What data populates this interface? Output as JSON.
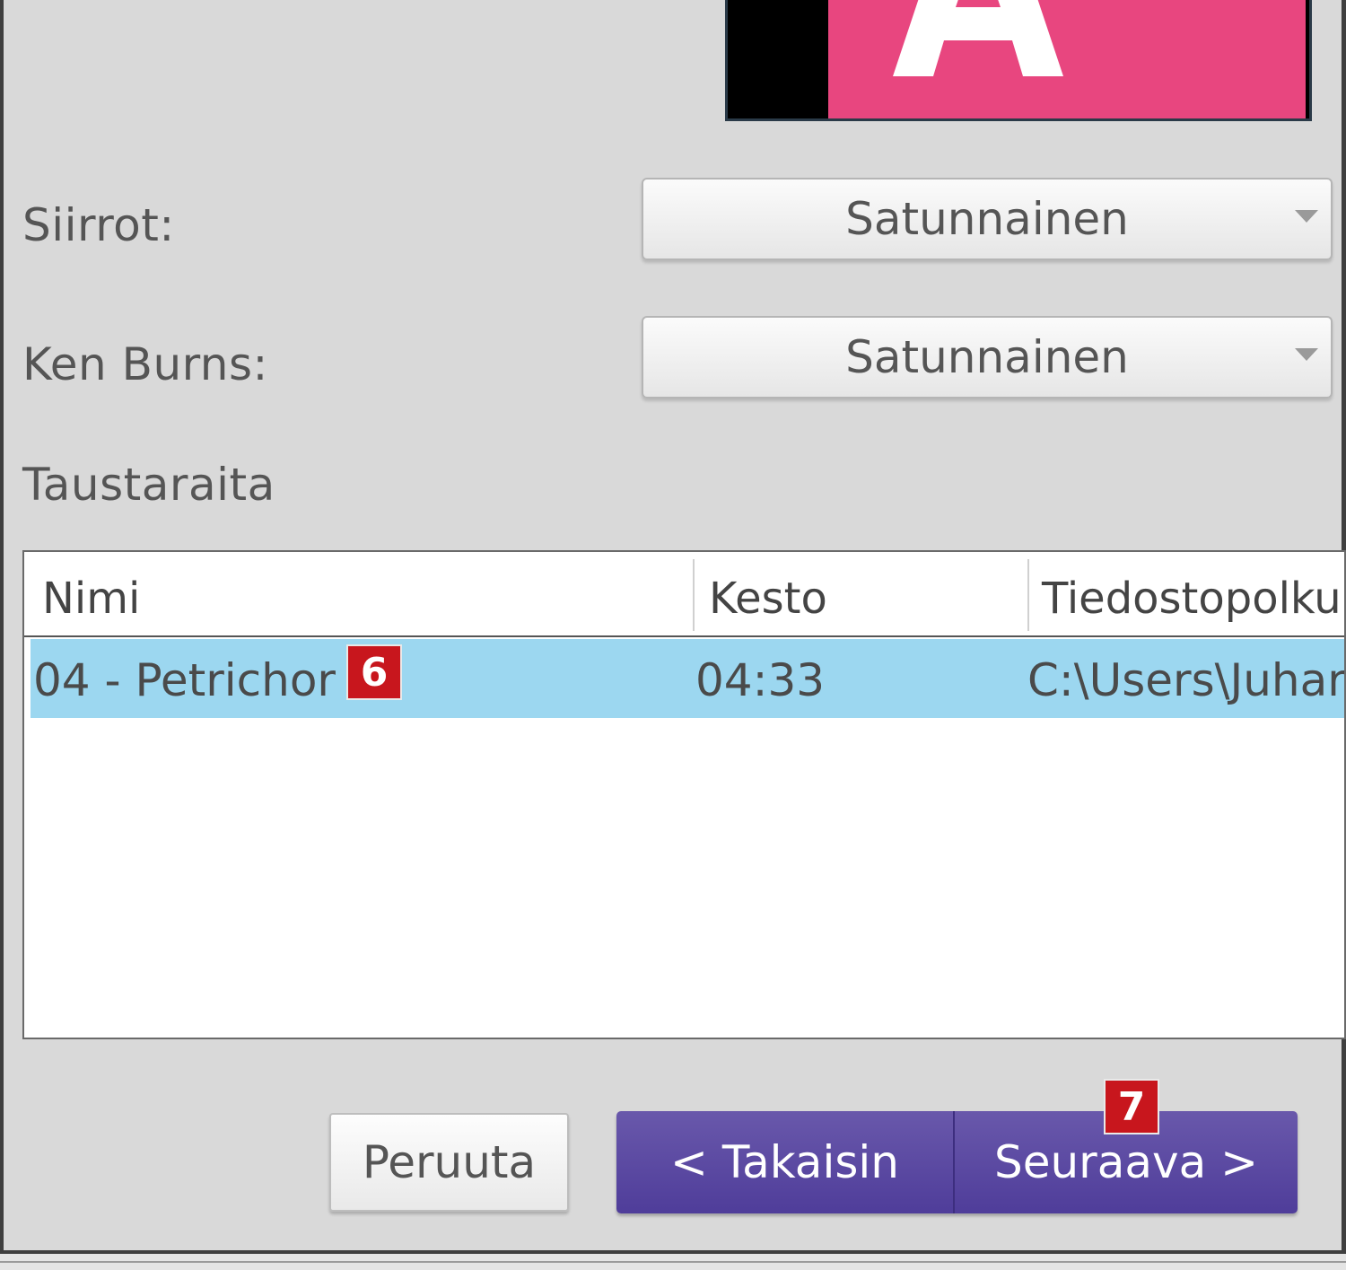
{
  "preview": {
    "letter": "A",
    "background_color": "#e8467f"
  },
  "fields": {
    "transitions": {
      "label": "Siirrot:",
      "value": "Satunnainen"
    },
    "ken_burns": {
      "label": "Ken Burns:",
      "value": "Satunnainen"
    }
  },
  "background_track": {
    "heading": "Taustaraita",
    "columns": [
      "Nimi",
      "Kesto",
      "Tiedostopolku"
    ],
    "rows": [
      {
        "name": "04 - Petrichor",
        "duration": "04:33",
        "path": "C:\\Users\\Juhar"
      }
    ]
  },
  "badges": {
    "row_marker": "6",
    "next_marker": "7"
  },
  "buttons": {
    "cancel": "Peruuta",
    "back": "< Takaisin",
    "next": "Seuraava >"
  },
  "colors": {
    "accent": "#5a48a3",
    "selection": "#9cd7f0",
    "badge": "#c8161d"
  }
}
